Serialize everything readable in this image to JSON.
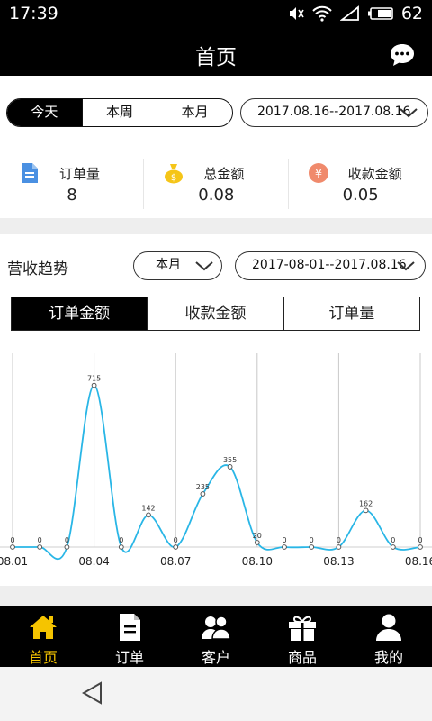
{
  "status_bar": {
    "time": "17:39",
    "battery": "62"
  },
  "header": {
    "title": "首页"
  },
  "range_tabs": [
    {
      "label": "今天",
      "active": true
    },
    {
      "label": "本周",
      "active": false
    },
    {
      "label": "本月",
      "active": false
    }
  ],
  "top_date_range": "2017.08.16--2017.08.16",
  "stats": [
    {
      "label": "订单量",
      "value": "8",
      "icon": "document-icon",
      "color": "#4a90e2"
    },
    {
      "label": "总金额",
      "value": "0.08",
      "icon": "money-bag-icon",
      "color": "#f5c518"
    },
    {
      "label": "收款金额",
      "value": "0.05",
      "icon": "yen-coin-icon",
      "color": "#f08a6c"
    }
  ],
  "trend": {
    "title": "营收趋势",
    "period_select": "本月",
    "date_range": "2017-08-01--2017.08.16",
    "tabs": [
      {
        "label": "订单金额",
        "active": true
      },
      {
        "label": "收款金额",
        "active": false
      },
      {
        "label": "订单量",
        "active": false
      }
    ]
  },
  "chart_data": {
    "type": "line",
    "x": [
      "08.01",
      "08.02",
      "08.03",
      "08.04",
      "08.05",
      "08.06",
      "08.07",
      "08.08",
      "08.09",
      "08.10",
      "08.11",
      "08.12",
      "08.13",
      "08.14",
      "08.15",
      "08.16"
    ],
    "x_tick_labels": [
      "08.01",
      "08.04",
      "08.07",
      "08.10",
      "08.13",
      "08.16"
    ],
    "series": [
      {
        "values": [
          0,
          0,
          0,
          715,
          0,
          142,
          0,
          235,
          355,
          20,
          0,
          0,
          0,
          162,
          0,
          0
        ]
      }
    ],
    "ylim": [
      0,
      800
    ],
    "line_color": "#29b6e6",
    "grid": "vertical lines at labeled ticks"
  },
  "bottom_nav": [
    {
      "label": "首页",
      "icon": "home-icon",
      "active": true
    },
    {
      "label": "订单",
      "icon": "order-document-icon",
      "active": false
    },
    {
      "label": "客户",
      "icon": "customers-icon",
      "active": false
    },
    {
      "label": "商品",
      "icon": "gift-box-icon",
      "active": false
    },
    {
      "label": "我的",
      "icon": "user-icon",
      "active": false
    }
  ]
}
